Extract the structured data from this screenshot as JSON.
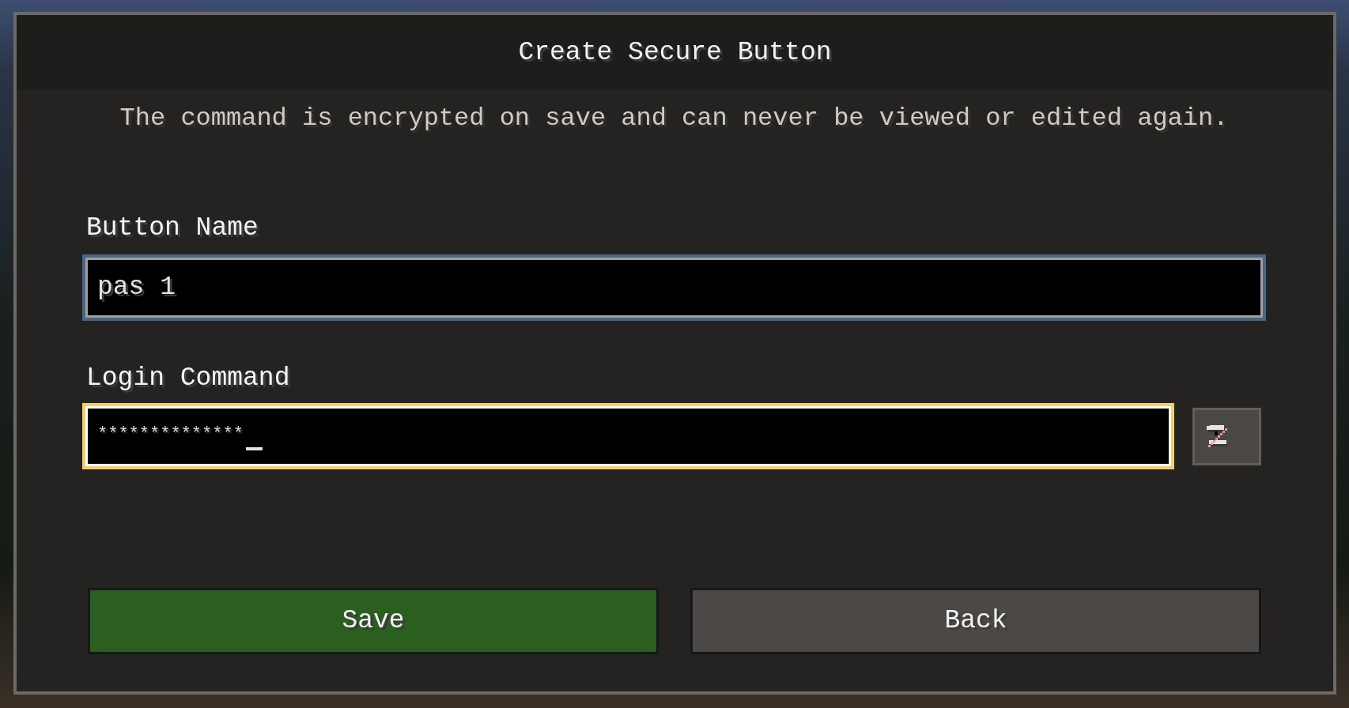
{
  "dialog": {
    "title": "Create Secure Button",
    "subtitle": "The command is encrypted on save and can never be viewed or edited again."
  },
  "fields": [
    {
      "label": "Button Name",
      "kind": "text",
      "value": "pas 1",
      "focused": false
    },
    {
      "label": "Login Command",
      "kind": "password",
      "value": "**************",
      "focused": true
    }
  ],
  "buttons": [
    {
      "label": "Save",
      "kind": "confirm"
    },
    {
      "label": "Back",
      "kind": "cancel"
    }
  ]
}
